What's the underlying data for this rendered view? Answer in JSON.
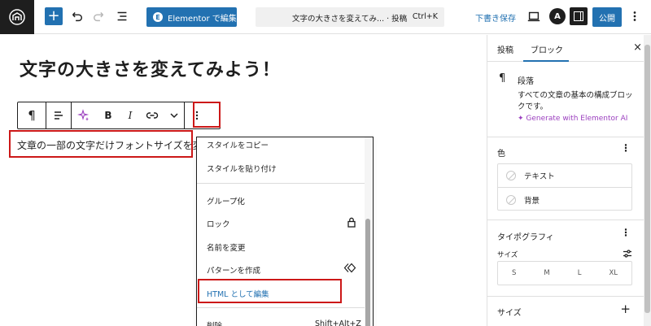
{
  "topbar": {
    "elementor_label": "Elementor で編集",
    "command_title": "文字の大きさを変えてみ... · 投稿",
    "command_shortcut": "Ctrl+K",
    "save_draft": "下書き保存",
    "publish": "公開",
    "avatar_letter": "A"
  },
  "canvas": {
    "post_title": "文字の大きさを変えてみよう！",
    "paragraph": "文章の一部の文字だけフォントサイズを変",
    "toolbar": {
      "paragraph_icon": "¶",
      "bold": "B",
      "italic": "I"
    }
  },
  "dropdown": {
    "items": [
      "スタイルをコピー",
      "スタイルを貼り付け",
      "グループ化",
      "ロック",
      "名前を変更",
      "パターンを作成",
      "HTML として編集",
      "削除"
    ],
    "delete_shortcut": "Shift+Alt+Z"
  },
  "sidebar": {
    "tab_post": "投稿",
    "tab_block": "ブロック",
    "close": "×",
    "block_icon": "¶",
    "block_name": "段落",
    "block_desc_1": "すべての文章の基本の構成ブロッ",
    "block_desc_2": "クです。",
    "ai_link": "Generate with Elementor AI",
    "color_title": "色",
    "color_text": "テキスト",
    "color_bg": "背景",
    "typography_title": "タイポグラフィ",
    "size_label": "サイズ",
    "sizes": [
      "S",
      "M",
      "L",
      "XL"
    ],
    "size_section": "サイズ"
  },
  "colors": {
    "accent": "#2271b1",
    "highlight": "#cc1818",
    "ai_purple": "#9b3fbf"
  }
}
